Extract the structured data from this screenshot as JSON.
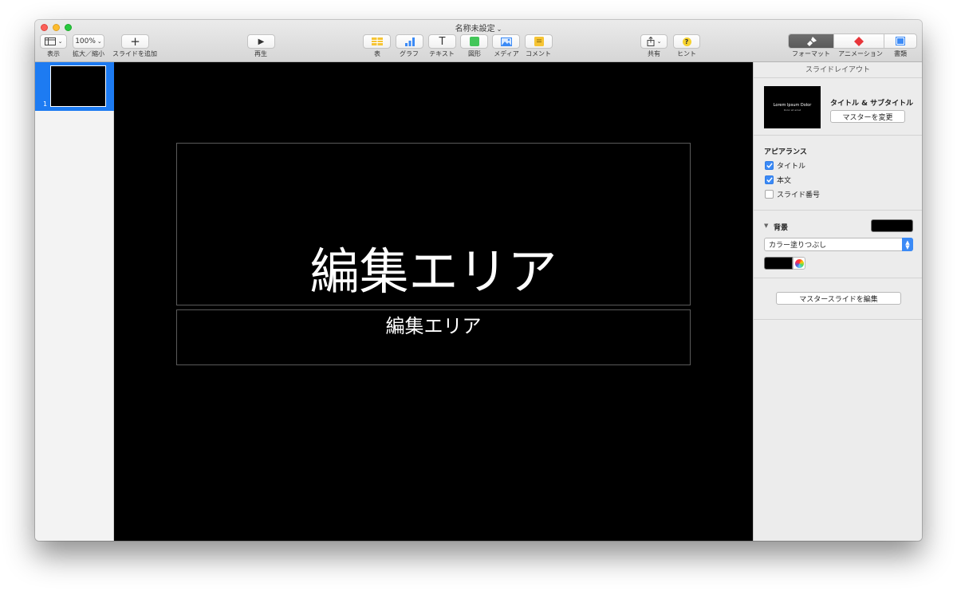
{
  "window": {
    "title": "名称未設定",
    "title_chevron": "⌄"
  },
  "toolbar": {
    "view": {
      "label": "表示",
      "icon": "sidebar-icon"
    },
    "zoom": {
      "value": "100%",
      "label": "拡大／縮小"
    },
    "add_slide": {
      "glyph": "+",
      "label": "スライドを追加"
    },
    "play": {
      "glyph": "▶",
      "label": "再生"
    },
    "table": {
      "label": "表",
      "icon": "table-icon",
      "color": "#f6c434"
    },
    "chart": {
      "label": "グラフ",
      "icon": "chart-icon",
      "color": "#3b8af6"
    },
    "text": {
      "glyph": "T",
      "label": "テキスト"
    },
    "shape": {
      "label": "図形",
      "icon": "shape-icon",
      "color": "#43c659"
    },
    "media": {
      "label": "メディア",
      "icon": "media-icon",
      "color": "#3b8af6"
    },
    "comment": {
      "label": "コメント",
      "icon": "comment-icon",
      "color": "#f6c434"
    },
    "share": {
      "label": "共有",
      "icon": "share-icon"
    },
    "tips": {
      "glyph": "?",
      "label": "ヒント",
      "color": "#f6d22e"
    },
    "format": {
      "label": "フォーマット",
      "icon": "paintbrush-icon",
      "active": true
    },
    "animate": {
      "label": "アニメーション",
      "icon": "diamond-icon",
      "color": "#e8353a"
    },
    "document": {
      "label": "書類",
      "icon": "document-icon",
      "color": "#3b8af6"
    }
  },
  "navigator": {
    "slides": [
      {
        "number": "1",
        "selected": true
      }
    ],
    "selection_color": "#1d7bf2"
  },
  "canvas": {
    "background": "#000000",
    "title_placeholder": "編集エリア",
    "body_placeholder": "編集エリア"
  },
  "inspector": {
    "header": "スライドレイアウト",
    "layout": {
      "name": "タイトル & サブタイトル",
      "thumb_title": "Lorem Ipsum Dolor",
      "thumb_subtitle": "Dolor sit amet",
      "change_master_button": "マスターを変更"
    },
    "appearance": {
      "heading": "アピアランス",
      "options": [
        {
          "label": "タイトル",
          "checked": true
        },
        {
          "label": "本文",
          "checked": true
        },
        {
          "label": "スライド番号",
          "checked": false
        }
      ]
    },
    "background": {
      "heading": "背景",
      "disclosure": "▼",
      "swatch_color": "#000000",
      "fill_type": "カラー塗りつぶし"
    },
    "edit_master_button": "マスタースライドを編集"
  }
}
